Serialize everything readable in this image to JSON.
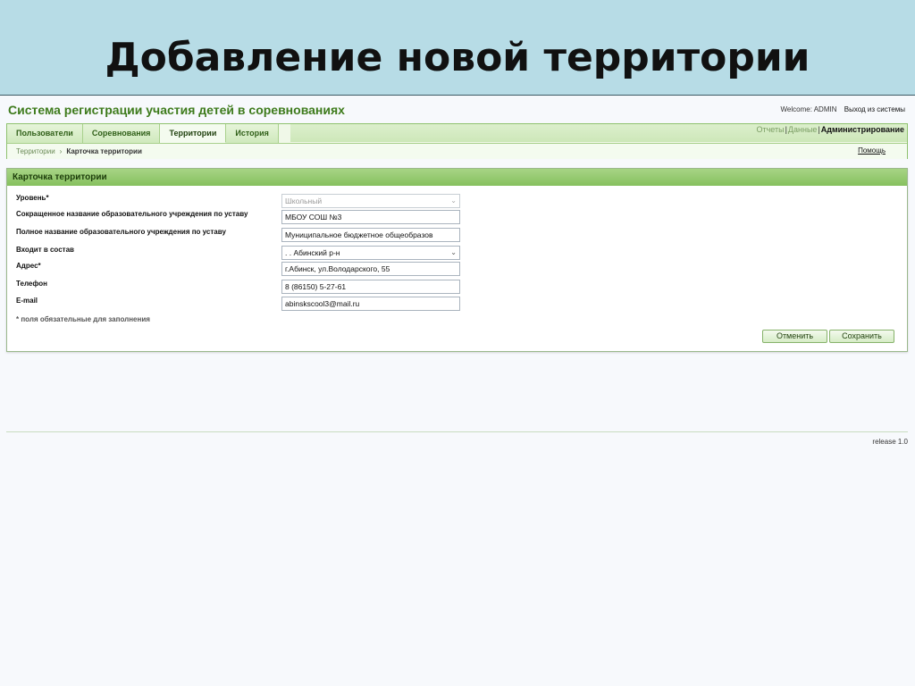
{
  "slide": {
    "title": "Добавление новой территории"
  },
  "app": {
    "title": "Система регистрации участия детей в соревнованиях",
    "user": {
      "welcome": "Welcome: ADMIN",
      "logout": "Выход из системы"
    },
    "tabs": [
      {
        "label": "Пользователи",
        "active": false
      },
      {
        "label": "Соревнования",
        "active": false
      },
      {
        "label": "Территории",
        "active": true
      },
      {
        "label": "История",
        "active": false
      }
    ],
    "modes": [
      {
        "label": "Отчеты"
      },
      {
        "label": "Данные"
      },
      {
        "label": "Администрирование",
        "current": true
      }
    ],
    "breadcrumb": {
      "root": "Территории",
      "arrow": "›",
      "current": "Карточка территории"
    },
    "help": "Помощь"
  },
  "form": {
    "title": "Карточка территории",
    "fields": [
      {
        "label": "Уровень*",
        "value": "Школьный",
        "type": "select",
        "disabled": true
      },
      {
        "label": "Сокращенное название образовательного учреждения по уставу",
        "value": "МБОУ СОШ №3",
        "type": "text"
      },
      {
        "label": "Полное название образовательного учреждения по уставу",
        "value": "Муниципальное бюджетное общеобразов",
        "type": "text"
      },
      {
        "label": "Входит в состав",
        "value": ". . Абинский р-н",
        "type": "select"
      },
      {
        "label": "Адрес*",
        "value": "г.Абинск, ул.Володарского, 55",
        "type": "text"
      },
      {
        "label": "Телефон",
        "value": "8 (86150) 5-27-61",
        "type": "text"
      },
      {
        "label": "E-mail",
        "value": "abinskscool3@mail.ru",
        "type": "text"
      }
    ],
    "required_note": "* поля обязательные для заполнения",
    "buttons": {
      "cancel": "Отменить",
      "save": "Сохранить"
    }
  },
  "footer": {
    "release": "release 1.0"
  },
  "colors": {
    "header_bg": "#b7dce6",
    "accent_green": "#3e7b1c",
    "card_head": "#86c05e"
  }
}
